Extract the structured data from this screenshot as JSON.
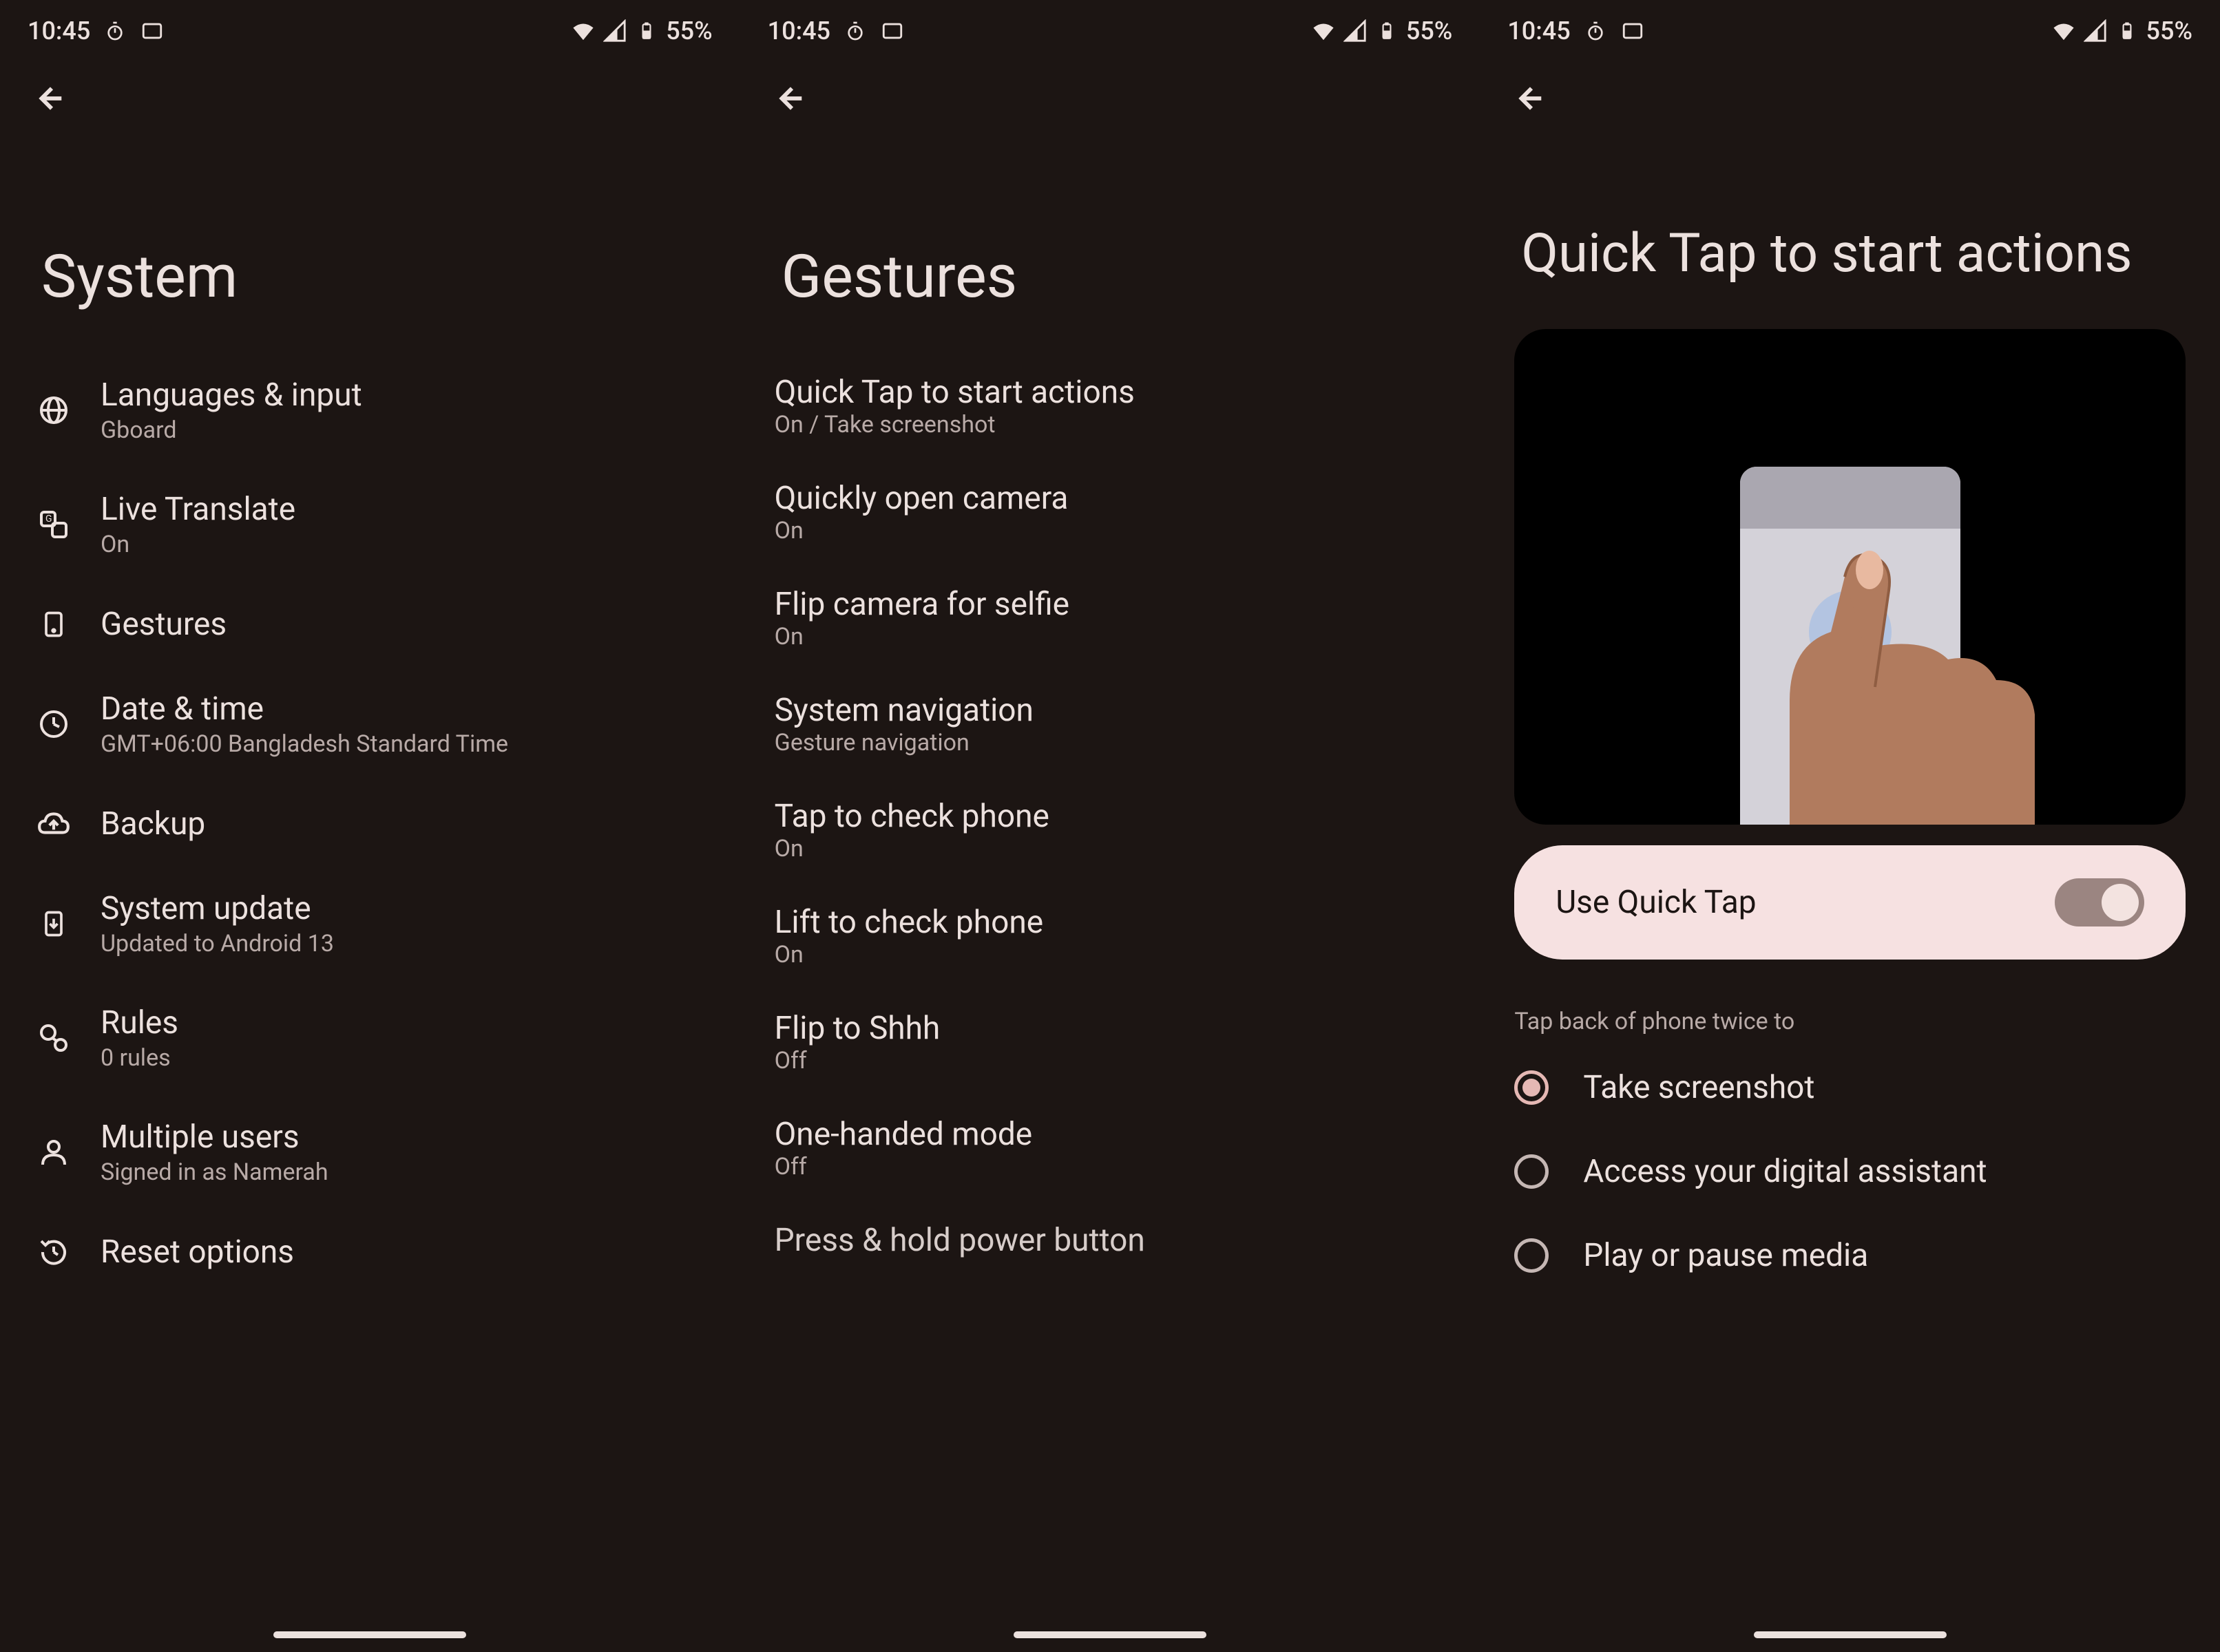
{
  "status": {
    "time": "10:45",
    "battery_pct": "55%"
  },
  "screen1": {
    "title": "System",
    "items": [
      {
        "icon": "globe-icon",
        "title": "Languages & input",
        "subtitle": "Gboard"
      },
      {
        "icon": "translate-icon",
        "title": "Live Translate",
        "subtitle": "On"
      },
      {
        "icon": "gesture-icon",
        "title": "Gestures",
        "subtitle": ""
      },
      {
        "icon": "clock-icon",
        "title": "Date & time",
        "subtitle": "GMT+06:00 Bangladesh Standard Time"
      },
      {
        "icon": "cloud-icon",
        "title": "Backup",
        "subtitle": ""
      },
      {
        "icon": "update-icon",
        "title": "System update",
        "subtitle": "Updated to Android 13"
      },
      {
        "icon": "rules-icon",
        "title": "Rules",
        "subtitle": "0 rules"
      },
      {
        "icon": "users-icon",
        "title": "Multiple users",
        "subtitle": "Signed in as Namerah"
      },
      {
        "icon": "reset-icon",
        "title": "Reset options",
        "subtitle": ""
      }
    ]
  },
  "screen2": {
    "title": "Gestures",
    "items": [
      {
        "title": "Quick Tap to start actions",
        "subtitle": "On / Take screenshot"
      },
      {
        "title": "Quickly open camera",
        "subtitle": "On"
      },
      {
        "title": "Flip camera for selfie",
        "subtitle": "On"
      },
      {
        "title": "System navigation",
        "subtitle": "Gesture navigation"
      },
      {
        "title": "Tap to check phone",
        "subtitle": "On"
      },
      {
        "title": "Lift to check phone",
        "subtitle": "On"
      },
      {
        "title": "Flip to Shhh",
        "subtitle": "Off"
      },
      {
        "title": "One-handed mode",
        "subtitle": "Off"
      },
      {
        "title": "Press & hold power button",
        "subtitle": ""
      }
    ]
  },
  "screen3": {
    "title": "Quick Tap to start actions",
    "toggle_label": "Use Quick Tap",
    "toggle_on": true,
    "section_header": "Tap back of phone twice to",
    "options": [
      {
        "label": "Take screenshot",
        "checked": true
      },
      {
        "label": "Access your digital assistant",
        "checked": false
      },
      {
        "label": "Play or pause media",
        "checked": false
      }
    ]
  }
}
